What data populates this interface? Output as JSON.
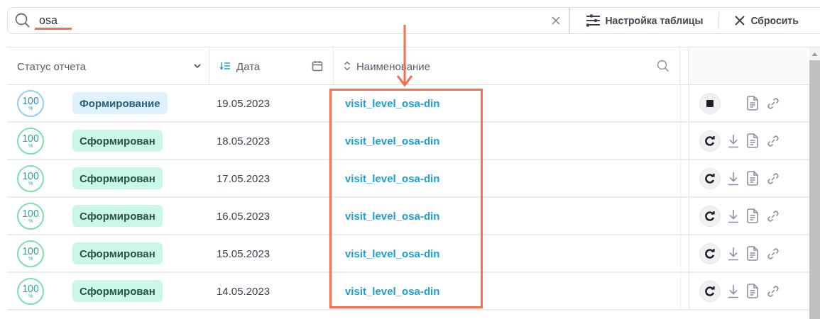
{
  "search": {
    "value": "osa"
  },
  "toolbar": {
    "settings_button": "Настройка таблицы",
    "reset_button": "Сбросить"
  },
  "table": {
    "columns": [
      {
        "label": "Статус отчета",
        "kind": "dropdown"
      },
      {
        "label": "Дата",
        "kind": "calendar"
      },
      {
        "label": "Наименование",
        "kind": "search"
      }
    ],
    "rows": [
      {
        "progress": "100",
        "unit": "%",
        "status": "Формирование",
        "kind": "forming",
        "date": "19.05.2023",
        "name": "visit_level_osa-din"
      },
      {
        "progress": "100",
        "unit": "%",
        "status": "Сформирован",
        "kind": "formed",
        "date": "18.05.2023",
        "name": "visit_level_osa-din"
      },
      {
        "progress": "100",
        "unit": "%",
        "status": "Сформирован",
        "kind": "formed",
        "date": "17.05.2023",
        "name": "visit_level_osa-din"
      },
      {
        "progress": "100",
        "unit": "%",
        "status": "Сформирован",
        "kind": "formed",
        "date": "16.05.2023",
        "name": "visit_level_osa-din"
      },
      {
        "progress": "100",
        "unit": "%",
        "status": "Сформирован",
        "kind": "formed",
        "date": "15.05.2023",
        "name": "visit_level_osa-din"
      },
      {
        "progress": "100",
        "unit": "%",
        "status": "Сформирован",
        "kind": "formed",
        "date": "14.05.2023",
        "name": "visit_level_osa-din"
      }
    ]
  }
}
